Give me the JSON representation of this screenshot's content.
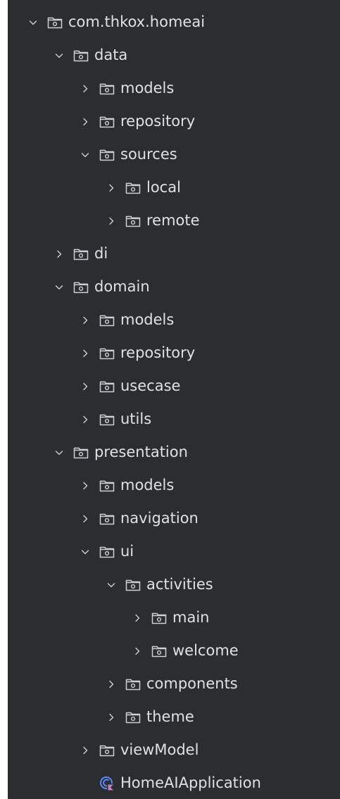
{
  "colors": {
    "background": "#2b2d30",
    "text": "#dfe1e5",
    "icon": "#ced0d6",
    "app_icon_primary": "#548af7",
    "app_icon_accent": "#c77dbb"
  },
  "tree": [
    {
      "label": "com.thkox.homeai",
      "depth": 0,
      "state": "expanded",
      "icon": "package-folder-icon"
    },
    {
      "label": "data",
      "depth": 1,
      "state": "expanded",
      "icon": "package-folder-icon"
    },
    {
      "label": "models",
      "depth": 2,
      "state": "collapsed",
      "icon": "package-folder-icon"
    },
    {
      "label": "repository",
      "depth": 2,
      "state": "collapsed",
      "icon": "package-folder-icon"
    },
    {
      "label": "sources",
      "depth": 2,
      "state": "expanded",
      "icon": "package-folder-icon"
    },
    {
      "label": "local",
      "depth": 3,
      "state": "collapsed",
      "icon": "package-folder-icon"
    },
    {
      "label": "remote",
      "depth": 3,
      "state": "collapsed",
      "icon": "package-folder-icon"
    },
    {
      "label": "di",
      "depth": 1,
      "state": "collapsed",
      "icon": "package-folder-icon"
    },
    {
      "label": "domain",
      "depth": 1,
      "state": "expanded",
      "icon": "package-folder-icon"
    },
    {
      "label": "models",
      "depth": 2,
      "state": "collapsed",
      "icon": "package-folder-icon"
    },
    {
      "label": "repository",
      "depth": 2,
      "state": "collapsed",
      "icon": "package-folder-icon"
    },
    {
      "label": "usecase",
      "depth": 2,
      "state": "collapsed",
      "icon": "package-folder-icon"
    },
    {
      "label": "utils",
      "depth": 2,
      "state": "collapsed",
      "icon": "package-folder-icon"
    },
    {
      "label": "presentation",
      "depth": 1,
      "state": "expanded",
      "icon": "package-folder-icon"
    },
    {
      "label": "models",
      "depth": 2,
      "state": "collapsed",
      "icon": "package-folder-icon"
    },
    {
      "label": "navigation",
      "depth": 2,
      "state": "collapsed",
      "icon": "package-folder-icon"
    },
    {
      "label": "ui",
      "depth": 2,
      "state": "expanded",
      "icon": "package-folder-icon"
    },
    {
      "label": "activities",
      "depth": 3,
      "state": "expanded",
      "icon": "package-folder-icon"
    },
    {
      "label": "main",
      "depth": 4,
      "state": "collapsed",
      "icon": "package-folder-icon"
    },
    {
      "label": "welcome",
      "depth": 4,
      "state": "collapsed",
      "icon": "package-folder-icon"
    },
    {
      "label": "components",
      "depth": 3,
      "state": "collapsed",
      "icon": "package-folder-icon"
    },
    {
      "label": "theme",
      "depth": 3,
      "state": "collapsed",
      "icon": "package-folder-icon"
    },
    {
      "label": "viewModel",
      "depth": 2,
      "state": "collapsed",
      "icon": "package-folder-icon"
    },
    {
      "label": "HomeAIApplication",
      "depth": 2,
      "state": "leaf",
      "icon": "kotlin-application-class-icon"
    }
  ]
}
